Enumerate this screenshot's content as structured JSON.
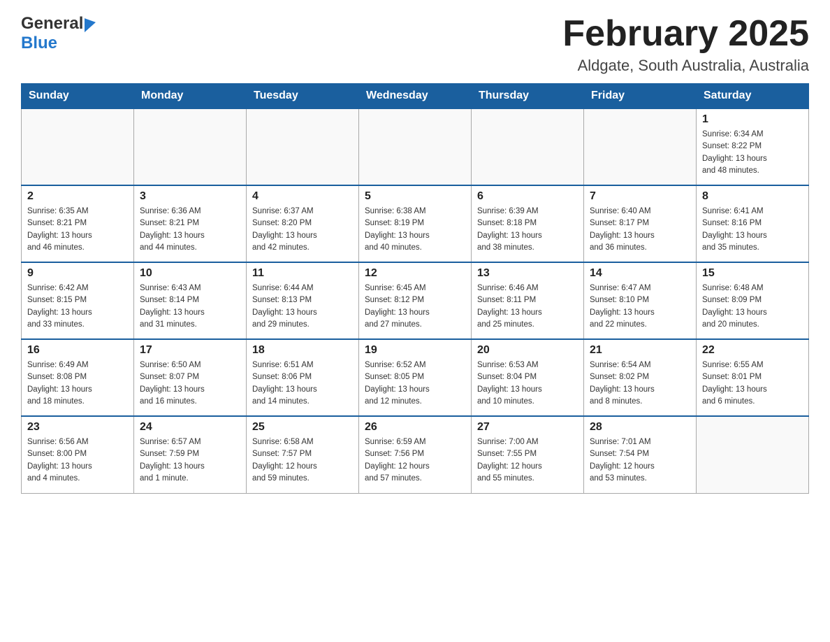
{
  "header": {
    "logo_general": "General",
    "logo_blue": "Blue",
    "month_title": "February 2025",
    "location": "Aldgate, South Australia, Australia"
  },
  "weekdays": [
    "Sunday",
    "Monday",
    "Tuesday",
    "Wednesday",
    "Thursday",
    "Friday",
    "Saturday"
  ],
  "weeks": [
    {
      "days": [
        {
          "number": "",
          "info": ""
        },
        {
          "number": "",
          "info": ""
        },
        {
          "number": "",
          "info": ""
        },
        {
          "number": "",
          "info": ""
        },
        {
          "number": "",
          "info": ""
        },
        {
          "number": "",
          "info": ""
        },
        {
          "number": "1",
          "info": "Sunrise: 6:34 AM\nSunset: 8:22 PM\nDaylight: 13 hours\nand 48 minutes."
        }
      ]
    },
    {
      "days": [
        {
          "number": "2",
          "info": "Sunrise: 6:35 AM\nSunset: 8:21 PM\nDaylight: 13 hours\nand 46 minutes."
        },
        {
          "number": "3",
          "info": "Sunrise: 6:36 AM\nSunset: 8:21 PM\nDaylight: 13 hours\nand 44 minutes."
        },
        {
          "number": "4",
          "info": "Sunrise: 6:37 AM\nSunset: 8:20 PM\nDaylight: 13 hours\nand 42 minutes."
        },
        {
          "number": "5",
          "info": "Sunrise: 6:38 AM\nSunset: 8:19 PM\nDaylight: 13 hours\nand 40 minutes."
        },
        {
          "number": "6",
          "info": "Sunrise: 6:39 AM\nSunset: 8:18 PM\nDaylight: 13 hours\nand 38 minutes."
        },
        {
          "number": "7",
          "info": "Sunrise: 6:40 AM\nSunset: 8:17 PM\nDaylight: 13 hours\nand 36 minutes."
        },
        {
          "number": "8",
          "info": "Sunrise: 6:41 AM\nSunset: 8:16 PM\nDaylight: 13 hours\nand 35 minutes."
        }
      ]
    },
    {
      "days": [
        {
          "number": "9",
          "info": "Sunrise: 6:42 AM\nSunset: 8:15 PM\nDaylight: 13 hours\nand 33 minutes."
        },
        {
          "number": "10",
          "info": "Sunrise: 6:43 AM\nSunset: 8:14 PM\nDaylight: 13 hours\nand 31 minutes."
        },
        {
          "number": "11",
          "info": "Sunrise: 6:44 AM\nSunset: 8:13 PM\nDaylight: 13 hours\nand 29 minutes."
        },
        {
          "number": "12",
          "info": "Sunrise: 6:45 AM\nSunset: 8:12 PM\nDaylight: 13 hours\nand 27 minutes."
        },
        {
          "number": "13",
          "info": "Sunrise: 6:46 AM\nSunset: 8:11 PM\nDaylight: 13 hours\nand 25 minutes."
        },
        {
          "number": "14",
          "info": "Sunrise: 6:47 AM\nSunset: 8:10 PM\nDaylight: 13 hours\nand 22 minutes."
        },
        {
          "number": "15",
          "info": "Sunrise: 6:48 AM\nSunset: 8:09 PM\nDaylight: 13 hours\nand 20 minutes."
        }
      ]
    },
    {
      "days": [
        {
          "number": "16",
          "info": "Sunrise: 6:49 AM\nSunset: 8:08 PM\nDaylight: 13 hours\nand 18 minutes."
        },
        {
          "number": "17",
          "info": "Sunrise: 6:50 AM\nSunset: 8:07 PM\nDaylight: 13 hours\nand 16 minutes."
        },
        {
          "number": "18",
          "info": "Sunrise: 6:51 AM\nSunset: 8:06 PM\nDaylight: 13 hours\nand 14 minutes."
        },
        {
          "number": "19",
          "info": "Sunrise: 6:52 AM\nSunset: 8:05 PM\nDaylight: 13 hours\nand 12 minutes."
        },
        {
          "number": "20",
          "info": "Sunrise: 6:53 AM\nSunset: 8:04 PM\nDaylight: 13 hours\nand 10 minutes."
        },
        {
          "number": "21",
          "info": "Sunrise: 6:54 AM\nSunset: 8:02 PM\nDaylight: 13 hours\nand 8 minutes."
        },
        {
          "number": "22",
          "info": "Sunrise: 6:55 AM\nSunset: 8:01 PM\nDaylight: 13 hours\nand 6 minutes."
        }
      ]
    },
    {
      "days": [
        {
          "number": "23",
          "info": "Sunrise: 6:56 AM\nSunset: 8:00 PM\nDaylight: 13 hours\nand 4 minutes."
        },
        {
          "number": "24",
          "info": "Sunrise: 6:57 AM\nSunset: 7:59 PM\nDaylight: 13 hours\nand 1 minute."
        },
        {
          "number": "25",
          "info": "Sunrise: 6:58 AM\nSunset: 7:57 PM\nDaylight: 12 hours\nand 59 minutes."
        },
        {
          "number": "26",
          "info": "Sunrise: 6:59 AM\nSunset: 7:56 PM\nDaylight: 12 hours\nand 57 minutes."
        },
        {
          "number": "27",
          "info": "Sunrise: 7:00 AM\nSunset: 7:55 PM\nDaylight: 12 hours\nand 55 minutes."
        },
        {
          "number": "28",
          "info": "Sunrise: 7:01 AM\nSunset: 7:54 PM\nDaylight: 12 hours\nand 53 minutes."
        },
        {
          "number": "",
          "info": ""
        }
      ]
    }
  ]
}
